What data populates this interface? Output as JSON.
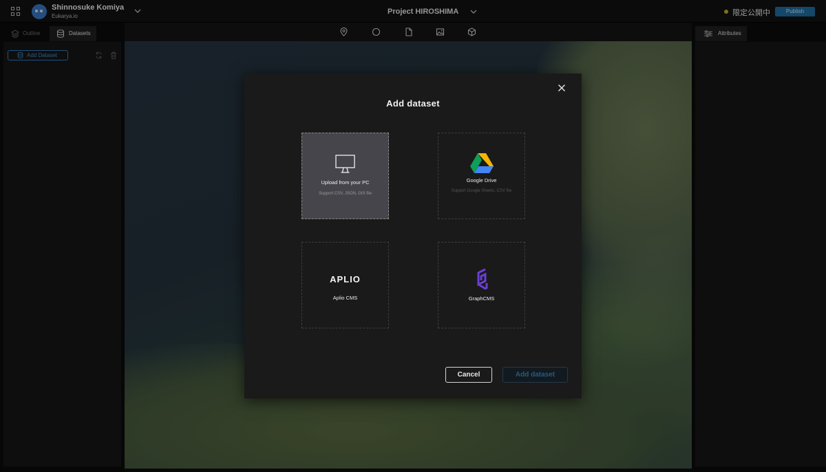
{
  "header": {
    "user_name": "Shinnosuke Komiya",
    "team_name": "Eukarya.io",
    "project_name": "Project HIROSHIMA",
    "publish_status": "限定公開中",
    "publish_label": "Publish",
    "status_color": "#c9a828",
    "accent_color": "#1f6ea3"
  },
  "left_panel": {
    "tabs": [
      {
        "label": "Outline",
        "icon": "layers-icon",
        "active": false
      },
      {
        "label": "Datasets",
        "icon": "database-icon",
        "active": true
      }
    ],
    "add_dataset_label": "Add Dataset"
  },
  "right_panel": {
    "tab_label": "Attributes",
    "tab_icon": "sliders-icon"
  },
  "toolbar": {
    "tools": [
      "marker-icon",
      "circle-icon",
      "file-icon",
      "image-icon",
      "cube-icon"
    ]
  },
  "modal": {
    "title": "Add  dataset",
    "options": [
      {
        "title": "Upload from your PC",
        "description": "Support CSV, JSON, GIS file",
        "icon": "monitor-icon",
        "selected": true
      },
      {
        "title": "Google Drive",
        "description": "Support Google Sheets, CSV file",
        "icon": "google-drive-icon",
        "selected": false
      },
      {
        "title": "Aplio CMS",
        "logo_text": "APLIO",
        "icon": "aplio-logo",
        "selected": false
      },
      {
        "title": "GraphCMS",
        "icon": "graphcms-logo",
        "selected": false
      }
    ],
    "cancel_label": "Cancel",
    "submit_label": "Add dataset"
  }
}
